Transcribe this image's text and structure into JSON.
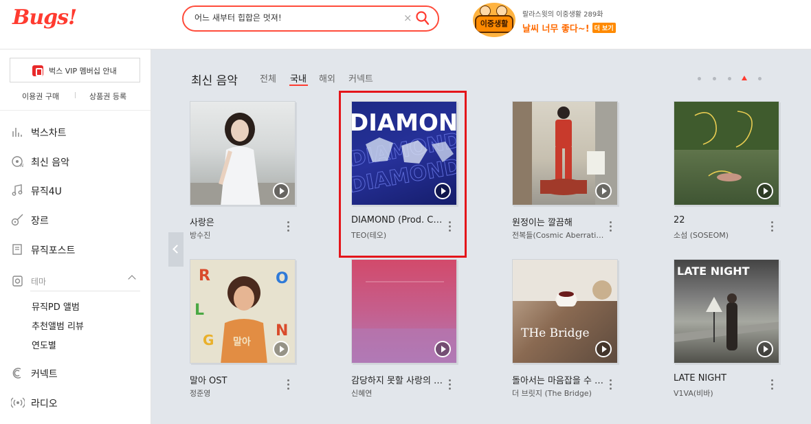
{
  "header": {
    "logo": "Bugs!",
    "search": {
      "value": "어느 새부터 힙합은 멋져!",
      "clear_glyph": "×"
    },
    "promo": {
      "badge_text": "이중생활",
      "subtitle": "랄라스윗의 이중생활 289화",
      "title": "날씨 너무 좋다~!",
      "more_label": "더 보기"
    }
  },
  "sidebar": {
    "vip_label": "벅스 VIP 멤버십 안내",
    "links": [
      "이용권 구매",
      "상품권 등록"
    ],
    "items": [
      {
        "label": "벅스차트",
        "icon": "chart-icon"
      },
      {
        "label": "최신 음악",
        "icon": "new-music-icon"
      },
      {
        "label": "뮤직4U",
        "icon": "music-note-icon"
      },
      {
        "label": "장르",
        "icon": "guitar-icon"
      },
      {
        "label": "뮤직포스트",
        "icon": "post-icon"
      },
      {
        "label": "테마",
        "icon": "theme-icon"
      },
      {
        "label": "커넥트",
        "icon": "connect-icon"
      },
      {
        "label": "라디오",
        "icon": "radio-icon"
      }
    ],
    "theme_sub": [
      "뮤직PD 앨범",
      "추천앨범 리뷰",
      "연도별"
    ]
  },
  "main": {
    "section_title": "최신 음악",
    "tabs": [
      "전체",
      "국내",
      "해외",
      "커넥트"
    ],
    "active_tab": "국내",
    "pagination": {
      "count": 5,
      "active": 4
    },
    "albums": [
      {
        "title": "사랑은",
        "artist": "방수진",
        "cover_text": ""
      },
      {
        "title": "DIAMOND (Prod. Cosmic Boy)",
        "artist": "TEO(테오)",
        "cover_text": "DIAMOND"
      },
      {
        "title": "원정이는 깔끔해",
        "artist": "전복들(Cosmic Aberration)",
        "cover_text": ""
      },
      {
        "title": "22",
        "artist": "소섬 (SOSEOM)",
        "cover_text": ""
      },
      {
        "title": "말아 OST",
        "artist": "정준영",
        "cover_text": "말아"
      },
      {
        "title": "감당하지 못할 사랑의 가시",
        "artist": "신혜연",
        "cover_text": ""
      },
      {
        "title": "돌아서는 마음잡을 수 없어",
        "artist": "더 브릿지 (The Bridge)",
        "cover_text": "THe Bridge"
      },
      {
        "title": "LATE NIGHT",
        "artist": "V1VA(비바)",
        "cover_text": "LATE NIGHT"
      }
    ]
  },
  "colors": {
    "accent": "#ff3b30",
    "main_bg": "#e2e6eb"
  }
}
